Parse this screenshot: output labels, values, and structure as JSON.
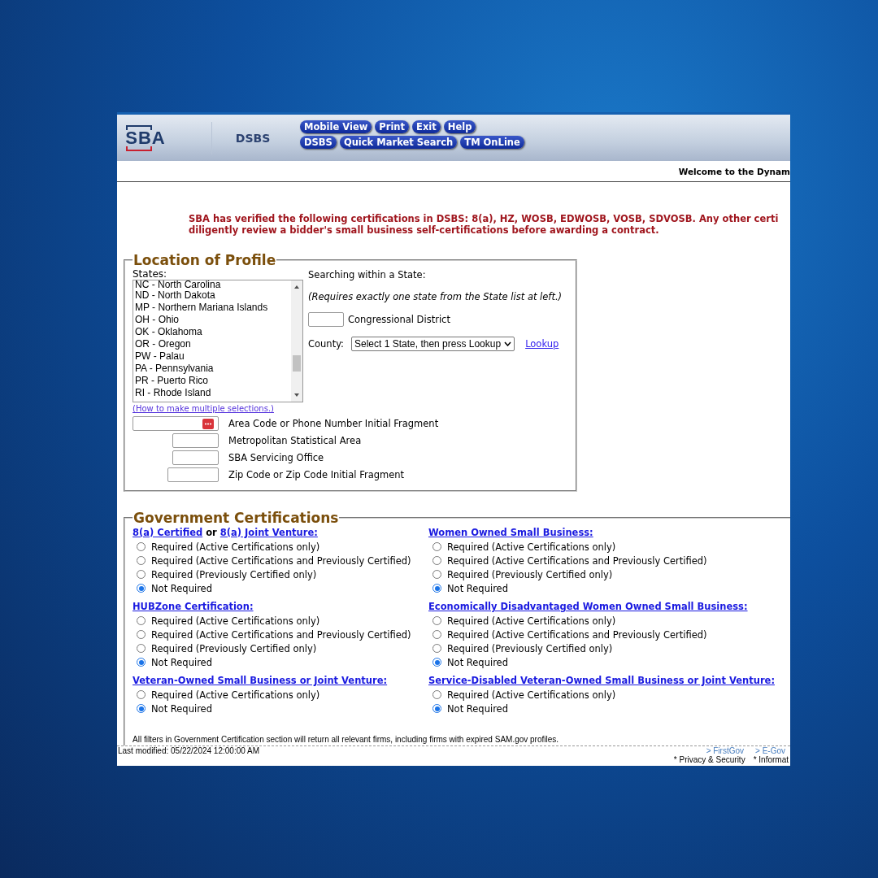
{
  "header": {
    "logo": "SBA",
    "app_name": "DSBS",
    "nav_rows": [
      [
        "Mobile View",
        "Print",
        "Exit",
        "Help"
      ],
      [
        "DSBS",
        "Quick Market Search",
        "TM OnLine"
      ]
    ]
  },
  "welcome": "Welcome to the Dynam",
  "notice": [
    "SBA has verified the following certifications in DSBS: 8(a), HZ, WOSB, EDWOSB, VOSB, SDVOSB. Any other certi",
    "diligently review a bidder's small business self-certifications before awarding a contract."
  ],
  "location": {
    "legend": "Location of Profile",
    "states_label": "States:",
    "states": [
      "NC - North Carolina",
      "ND - North Dakota",
      "MP - Northern Mariana Islands",
      "OH - Ohio",
      "OK - Oklahoma",
      "OR - Oregon",
      "PW - Palau",
      "PA - Pennsylvania",
      "PR - Puerto Rico",
      "RI - Rhode Island"
    ],
    "multi_help": "(How to make multiple selections.)",
    "within_label": "Searching within a State:",
    "within_note": "(Requires exactly one state from the State list at left.)",
    "district_label": "Congressional District",
    "county_label": "County:",
    "county_select": "Select 1 State, then press Lookup",
    "lookup": "Lookup",
    "fields": [
      {
        "label": "Area Code or Phone Number Initial Fragment",
        "kind": "phone"
      },
      {
        "label": "Metropolitan Statistical Area",
        "kind": "short"
      },
      {
        "label": "SBA Servicing Office",
        "kind": "short"
      },
      {
        "label": "Zip Code or Zip Code Initial Fragment",
        "kind": "medium"
      }
    ]
  },
  "certifications": {
    "legend": "Government Certifications",
    "groups": [
      {
        "title": [
          {
            "text": "8(a) Certified",
            "link": true
          },
          {
            "text": "or",
            "link": false
          },
          {
            "text": "8(a) Joint Venture:",
            "link": true
          }
        ],
        "options": [
          {
            "label": "Required (Active Certifications only)",
            "selected": false
          },
          {
            "label": "Required (Active Certifications and Previously Certified)",
            "selected": false
          },
          {
            "label": "Required (Previously Certified only)",
            "selected": false
          },
          {
            "label": "Not Required",
            "selected": true
          }
        ]
      },
      {
        "title": [
          {
            "text": "Women Owned Small Business:",
            "link": true
          }
        ],
        "options": [
          {
            "label": "Required (Active Certifications only)",
            "selected": false
          },
          {
            "label": "Required (Active Certifications and Previously Certified)",
            "selected": false
          },
          {
            "label": "Required (Previously Certified only)",
            "selected": false
          },
          {
            "label": "Not Required",
            "selected": true
          }
        ]
      },
      {
        "title": [
          {
            "text": "HUBZone Certification:",
            "link": true
          }
        ],
        "options": [
          {
            "label": "Required (Active Certifications only)",
            "selected": false
          },
          {
            "label": "Required (Active Certifications and Previously Certified)",
            "selected": false
          },
          {
            "label": "Required (Previously Certified only)",
            "selected": false
          },
          {
            "label": "Not Required",
            "selected": true
          }
        ]
      },
      {
        "title": [
          {
            "text": "Economically Disadvantaged Women Owned Small Business:",
            "link": true
          }
        ],
        "options": [
          {
            "label": "Required (Active Certifications only)",
            "selected": false
          },
          {
            "label": "Required (Active Certifications and Previously Certified)",
            "selected": false
          },
          {
            "label": "Required (Previously Certified only)",
            "selected": false
          },
          {
            "label": "Not Required",
            "selected": true
          }
        ]
      },
      {
        "title": [
          {
            "text": "Veteran-Owned Small Business or Joint Venture:",
            "link": true
          }
        ],
        "options": [
          {
            "label": "Required (Active Certifications only)",
            "selected": false
          },
          {
            "label": "Not Required",
            "selected": true
          }
        ]
      },
      {
        "title": [
          {
            "text": "Service-Disabled Veteran-Owned Small Business or Joint Venture:",
            "link": true
          }
        ],
        "options": [
          {
            "label": "Required (Active Certifications only)",
            "selected": false
          },
          {
            "label": "Not Required",
            "selected": true
          }
        ]
      }
    ],
    "note": "All filters in Government Certification section will return all relevant firms, including firms with expired SAM.gov profiles."
  },
  "footer": {
    "last_modified": "Last modified: 05/22/2024 12:00:00 AM",
    "links": [
      "> FirstGov",
      "> E-Gov"
    ],
    "bottom": [
      "* Privacy & Security",
      "* Informat"
    ]
  }
}
